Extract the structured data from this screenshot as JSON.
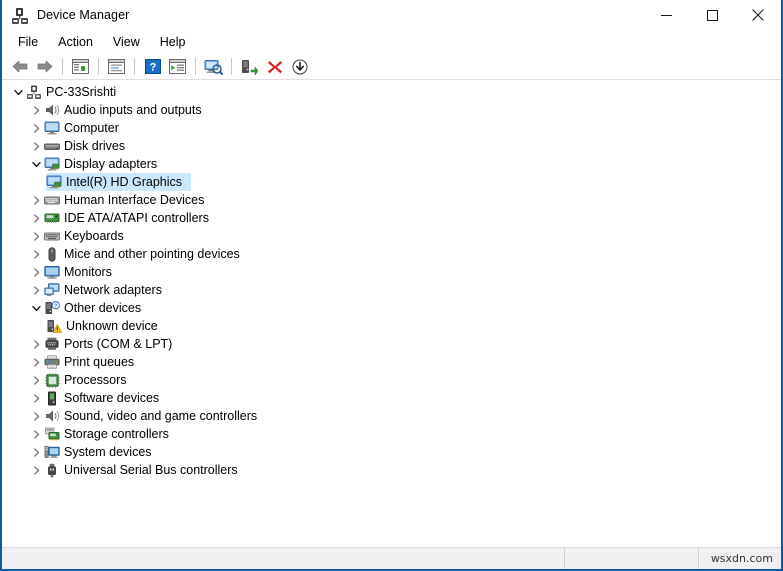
{
  "window": {
    "title": "Device Manager",
    "title_icon": "device-manager-icon",
    "minimize_label": "Minimize",
    "maximize_label": "Maximize",
    "close_label": "Close"
  },
  "menubar": {
    "items": [
      {
        "label": "File",
        "name": "menu-file"
      },
      {
        "label": "Action",
        "name": "menu-action"
      },
      {
        "label": "View",
        "name": "menu-view"
      },
      {
        "label": "Help",
        "name": "menu-help"
      }
    ]
  },
  "toolbar": {
    "buttons": [
      {
        "icon": "back-arrow-icon",
        "title": "Back"
      },
      {
        "icon": "forward-arrow-icon",
        "title": "Forward"
      },
      {
        "icon": "show-hide-console-tree-icon",
        "title": "Show/Hide Console Tree"
      },
      {
        "icon": "properties-icon",
        "title": "Properties"
      },
      {
        "icon": "help-icon",
        "title": "Help"
      },
      {
        "icon": "show-hide-action-pane-icon",
        "title": "Show/Hide Action Pane"
      },
      {
        "icon": "scan-for-hardware-changes-icon",
        "title": "Scan for hardware changes"
      },
      {
        "icon": "update-driver-icon",
        "title": "Update driver"
      },
      {
        "icon": "uninstall-device-icon",
        "title": "Uninstall device"
      },
      {
        "icon": "disable-device-icon",
        "title": "Disable device"
      }
    ]
  },
  "tree": {
    "nodes": [
      {
        "label": "PC-33Srishti",
        "level": 0,
        "state": "expanded",
        "icon": "computer-root-icon",
        "selected": false
      },
      {
        "label": "Audio inputs and outputs",
        "level": 1,
        "state": "collapsed",
        "icon": "speaker-icon",
        "selected": false
      },
      {
        "label": "Computer",
        "level": 1,
        "state": "collapsed",
        "icon": "monitor-icon",
        "selected": false
      },
      {
        "label": "Disk drives",
        "level": 1,
        "state": "collapsed",
        "icon": "disk-drive-icon",
        "selected": false
      },
      {
        "label": "Display adapters",
        "level": 1,
        "state": "expanded",
        "icon": "display-adapter-icon",
        "selected": false
      },
      {
        "label": "Intel(R) HD Graphics",
        "level": 2,
        "state": "leaf",
        "icon": "display-adapter-icon",
        "selected": true
      },
      {
        "label": "Human Interface Devices",
        "level": 1,
        "state": "collapsed",
        "icon": "hid-icon",
        "selected": false
      },
      {
        "label": "IDE ATA/ATAPI controllers",
        "level": 1,
        "state": "collapsed",
        "icon": "ide-controller-icon",
        "selected": false
      },
      {
        "label": "Keyboards",
        "level": 1,
        "state": "collapsed",
        "icon": "keyboard-icon",
        "selected": false
      },
      {
        "label": "Mice and other pointing devices",
        "level": 1,
        "state": "collapsed",
        "icon": "mouse-icon",
        "selected": false
      },
      {
        "label": "Monitors",
        "level": 1,
        "state": "collapsed",
        "icon": "monitor-icon",
        "selected": false
      },
      {
        "label": "Network adapters",
        "level": 1,
        "state": "collapsed",
        "icon": "network-adapter-icon",
        "selected": false
      },
      {
        "label": "Other devices",
        "level": 1,
        "state": "expanded",
        "icon": "other-device-icon",
        "selected": false
      },
      {
        "label": "Unknown device",
        "level": 2,
        "state": "leaf",
        "icon": "unknown-device-warning-icon",
        "selected": false
      },
      {
        "label": "Ports (COM & LPT)",
        "level": 1,
        "state": "collapsed",
        "icon": "port-icon",
        "selected": false
      },
      {
        "label": "Print queues",
        "level": 1,
        "state": "collapsed",
        "icon": "printer-icon",
        "selected": false
      },
      {
        "label": "Processors",
        "level": 1,
        "state": "collapsed",
        "icon": "processor-icon",
        "selected": false
      },
      {
        "label": "Software devices",
        "level": 1,
        "state": "collapsed",
        "icon": "software-device-icon",
        "selected": false
      },
      {
        "label": "Sound, video and game controllers",
        "level": 1,
        "state": "collapsed",
        "icon": "speaker-icon",
        "selected": false
      },
      {
        "label": "Storage controllers",
        "level": 1,
        "state": "collapsed",
        "icon": "storage-controller-icon",
        "selected": false
      },
      {
        "label": "System devices",
        "level": 1,
        "state": "collapsed",
        "icon": "system-device-icon",
        "selected": false
      },
      {
        "label": "Universal Serial Bus controllers",
        "level": 1,
        "state": "collapsed",
        "icon": "usb-icon",
        "selected": false
      }
    ]
  },
  "statusbar": {
    "main": "",
    "mid": "",
    "right": "wsxdn.com"
  },
  "colors": {
    "selection": "#cce8ff",
    "window_border": "#0b5ca8",
    "statusbar_bg": "#f0f0f0",
    "text": "#000000",
    "chevron_collapsed": "#767676",
    "chevron_expanded": "#1a1a1a"
  }
}
